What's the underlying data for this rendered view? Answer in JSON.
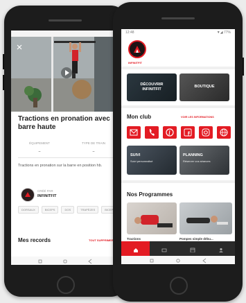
{
  "screen_a": {
    "exercise_title": "Tractions en pronation avec barre haute",
    "tabs": [
      "ÉQUIPEMENT",
      "TYPE DE TRAIN"
    ],
    "tab_values": [
      "–",
      "–"
    ],
    "description": "Tractions en pronation sur la barre en position hb.",
    "coach_label": "CRÉÉ PAR",
    "coach_name": "INFINITFIT",
    "tags": [
      "DORSAUX",
      "BICEPS",
      "DOS",
      "TRAPÈZES",
      "BICEPS"
    ],
    "records_title": "Mes records",
    "records_link": "TOUT SUPPRIMER"
  },
  "screen_b": {
    "status_time": "12:48",
    "status_right": "▼◢ 77%",
    "profile_name": "INFINITFIT",
    "banners": [
      "DÉCOUVRIR INFINITFIT",
      "BOUTIQUE"
    ],
    "club_title": "Mon club",
    "club_link": "VOIR LES INFORMATIONS",
    "club_icons": [
      "mail-icon",
      "phone-icon",
      "pinterest-icon",
      "facebook-icon",
      "instagram-icon",
      "globe-icon"
    ],
    "activity_cards": [
      {
        "title": "SUIVI",
        "subtitle": "Suivi personnalisé"
      },
      {
        "title": "PLANNING",
        "subtitle": "Réserver vos séances"
      }
    ],
    "programs_title": "Nos Programmes",
    "programs": [
      "Tractions",
      "Pompes simple débu..."
    ],
    "nav": [
      "Accueil",
      "Club",
      "Séances",
      "Profil"
    ],
    "nav_icons": [
      "home-icon",
      "club-icon",
      "sessions-icon",
      "profile-icon"
    ]
  },
  "colors": {
    "accent": "#e31b23",
    "frame": "#1c1c1c",
    "background": "#ececec"
  }
}
